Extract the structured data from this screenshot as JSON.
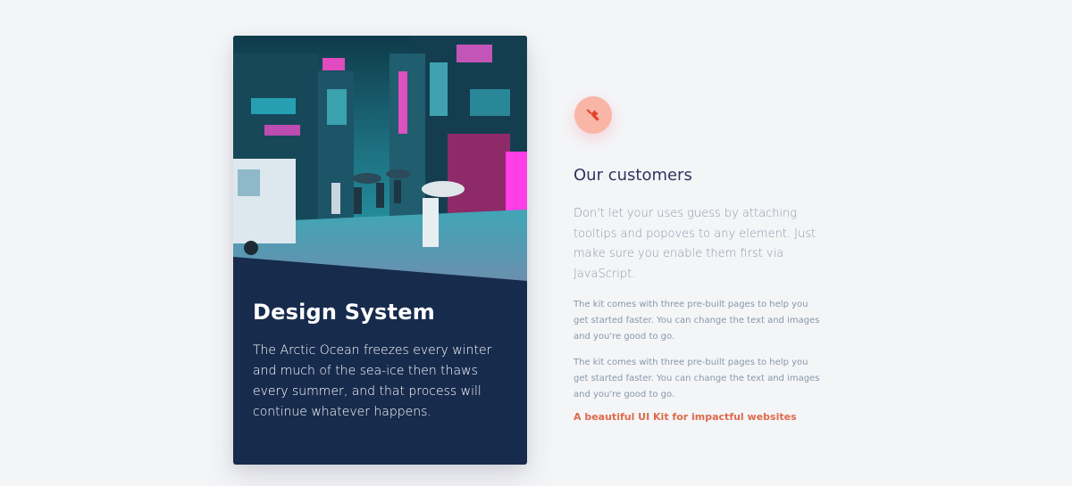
{
  "card": {
    "image_alt": "Neon-lit rainy city street at night",
    "title": "Design System",
    "text": "The Arctic Ocean freezes every winter and much of the sea-ice then thaws every summer, and that process will continue whatever happens."
  },
  "info": {
    "icon": "tools-icon",
    "title": "Our customers",
    "lead": "Don't let your uses guess by attaching tooltips and popoves to any element. Just make sure you enable them first via JavaScript.",
    "paragraphs": [
      "The kit comes with three pre-built pages to help you get started faster. You can change the text and images and you're good to go.",
      "The kit comes with three pre-built pages to help you get started faster. You can change the text and images and you're good to go."
    ],
    "link_label": "A beautiful UI Kit for impactful websites"
  },
  "colors": {
    "card_bg": "#172b4d",
    "accent": "#de6a4c",
    "icon_bg": "#f9b6a6",
    "page_bg": "#f4f5f7"
  }
}
